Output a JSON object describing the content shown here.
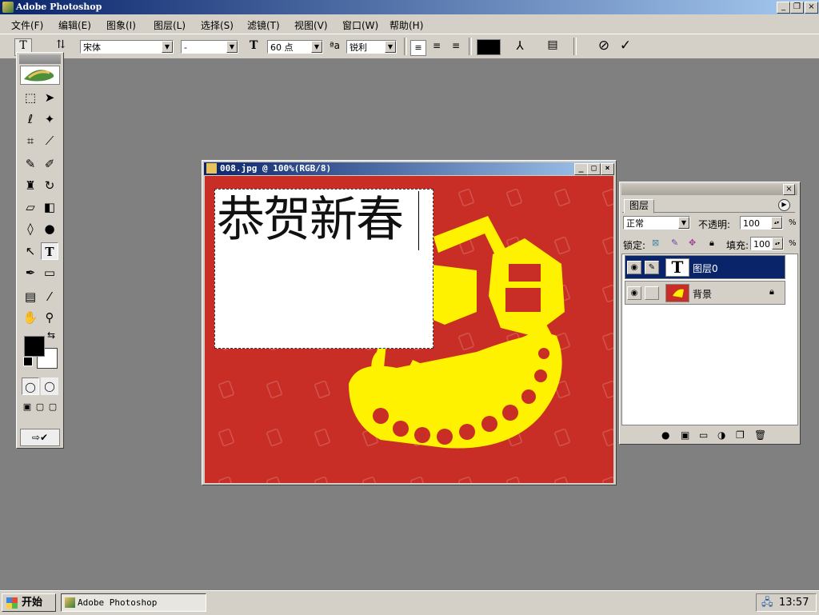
{
  "app": {
    "title": "Adobe Photoshop"
  },
  "menu": [
    "文件(F)",
    "编辑(E)",
    "图象(I)",
    "图层(L)",
    "选择(S)",
    "滤镜(T)",
    "视图(V)",
    "窗口(W)",
    "帮助(H)"
  ],
  "options": {
    "font_family": "宋体",
    "font_style": "-",
    "size_icon": "T",
    "font_size": "60 点",
    "aa_icon": "ªa",
    "antialias": "锐利",
    "text_color": "#000000"
  },
  "document": {
    "title": "008.jpg @ 100%(RGB/8)",
    "text": "恭贺新春",
    "bg_color": "#c82e26",
    "art_color": "#fff200"
  },
  "layers_panel": {
    "tab": "图层",
    "blend_mode": "正常",
    "opacity_label": "不透明:",
    "opacity": "100",
    "lock_label": "锁定:",
    "fill_label": "填充:",
    "fill": "100",
    "percent": "%",
    "layers": [
      {
        "name": "图层0",
        "thumb": "T",
        "selected": true
      },
      {
        "name": "背景",
        "locked": true
      }
    ]
  },
  "taskbar": {
    "start": "开始",
    "task": "Adobe Photoshop",
    "clock": "13:57"
  },
  "icons": {
    "minimize": "_",
    "maximize": "□",
    "close": "×",
    "restore": "❐",
    "cancel": "⊘",
    "commit": "✓"
  }
}
